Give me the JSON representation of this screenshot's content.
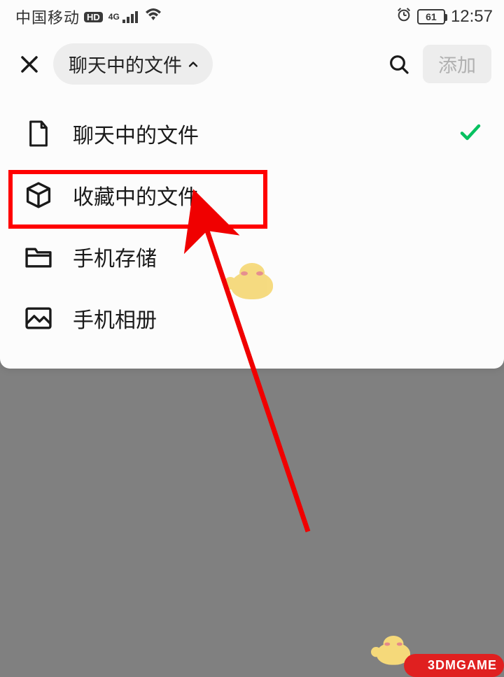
{
  "status": {
    "carrier": "中国移动",
    "hd": "HD",
    "net": "4G",
    "battery_pct": "61",
    "time": "12:57"
  },
  "header": {
    "chip_label": "聊天中的文件",
    "add_label": "添加"
  },
  "menu": {
    "items": [
      {
        "label": "聊天中的文件",
        "icon": "file",
        "selected": true
      },
      {
        "label": "收藏中的文件",
        "icon": "cube",
        "selected": false
      },
      {
        "label": "手机存储",
        "icon": "folder",
        "selected": false
      },
      {
        "label": "手机相册",
        "icon": "image",
        "selected": false
      }
    ]
  },
  "annotation": {
    "highlight_index": 1,
    "arrow_color": "#f00000"
  },
  "brand": {
    "text": "3DMGAME"
  }
}
